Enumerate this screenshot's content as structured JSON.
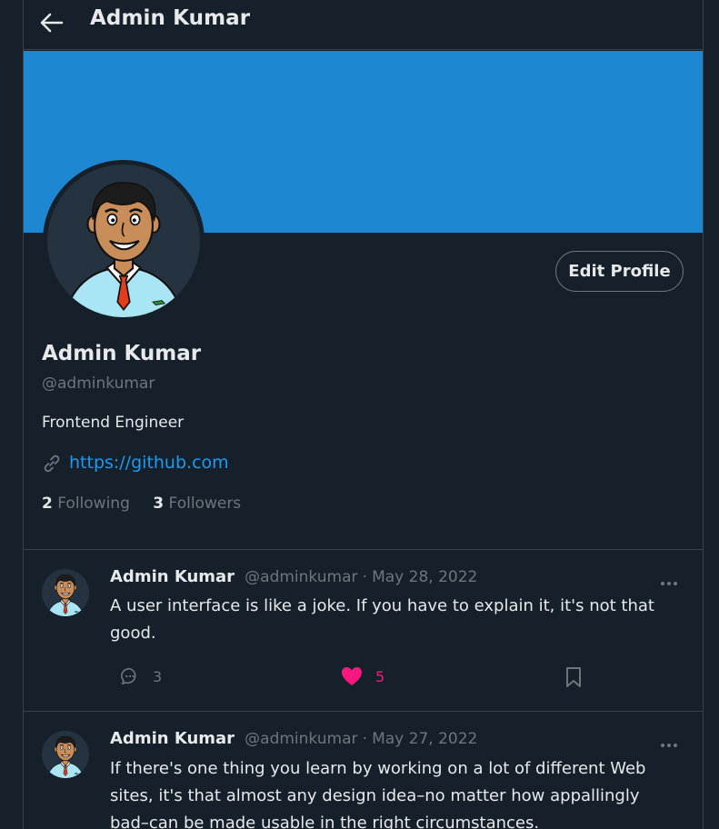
{
  "header": {
    "title": "Admin Kumar"
  },
  "colors": {
    "background": "#15202b",
    "banner": "#1e87d1",
    "accent": "#1d9bf0",
    "like": "#f91880",
    "muted": "#6e767d"
  },
  "profile": {
    "name": "Admin Kumar",
    "handle": "@adminkumar",
    "bio": "Frontend Engineer",
    "link": "https://github.com",
    "following_count": "2",
    "following_label": "Following",
    "followers_count": "3",
    "followers_label": "Followers",
    "edit_label": "Edit Profile"
  },
  "tweets": [
    {
      "name": "Admin Kumar",
      "handle": "@adminkumar",
      "sep": "·",
      "date": "May 28, 2022",
      "text": "A user interface is like a joke. If you have to explain it, it's not that good.",
      "replies": "3",
      "likes": "5"
    },
    {
      "name": "Admin Kumar",
      "handle": "@adminkumar",
      "sep": "·",
      "date": "May 27, 2022",
      "text": "If there's one thing you learn by working on a lot of different Web sites, it's that almost any design idea–no matter how appallingly bad–can be made usable in the right circumstances."
    }
  ]
}
